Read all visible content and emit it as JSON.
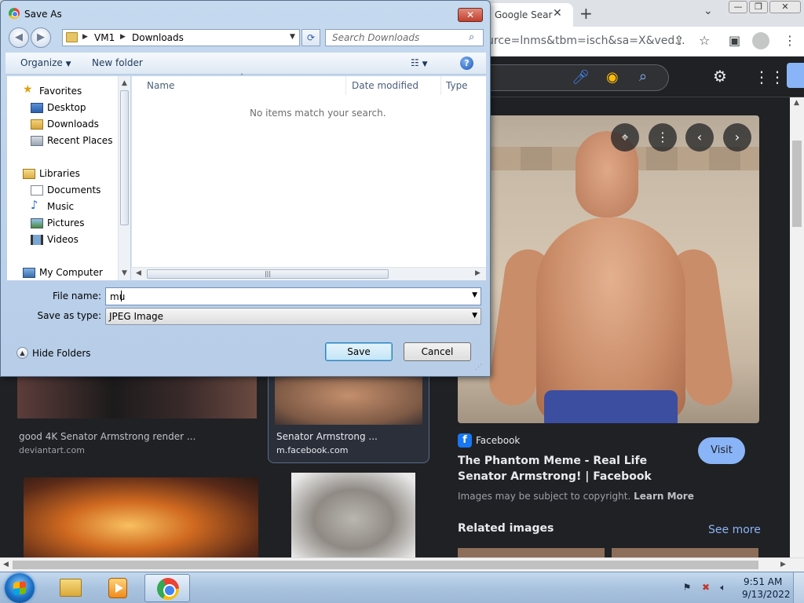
{
  "browser": {
    "tab_title": "Google Sear",
    "url_fragment": "urce=lnms&tbm=isch&sa=X&ved...",
    "tab_close": "✕",
    "new_tab": "+",
    "tab_search_icon": "chevron-down-icon",
    "window_controls": [
      "minimize",
      "maximize",
      "close"
    ]
  },
  "google": {
    "results": [
      {
        "caption": "good 4K Senator Armstrong render ...",
        "source": "deviantart.com"
      },
      {
        "caption": "Senator Armstrong ...",
        "source": "m.facebook.com",
        "selected": true
      }
    ],
    "preview": {
      "source_name": "Facebook",
      "source_logo": "f",
      "title": "The Phantom Meme - Real Life Senator Armstrong! | Facebook",
      "visit_label": "Visit",
      "copyright_text": "Images may be subject to copyright.",
      "learn_more": "Learn More",
      "related_label": "Related images",
      "see_more": "See more"
    },
    "accent_color": "#8ab4f8"
  },
  "dialog": {
    "title": "Save As",
    "close_label": "✕",
    "breadcrumb": [
      "VM1",
      "Downloads"
    ],
    "search_placeholder": "Search Downloads",
    "toolbar": {
      "organize": "Organize",
      "new_folder": "New folder",
      "help": "?"
    },
    "nav": {
      "favorites": "Favorites",
      "desktop": "Desktop",
      "downloads": "Downloads",
      "recent_places": "Recent Places",
      "libraries": "Libraries",
      "documents": "Documents",
      "music": "Music",
      "pictures": "Pictures",
      "videos": "Videos",
      "my_computer": "My Computer"
    },
    "columns": {
      "name": "Name",
      "date_modified": "Date modified",
      "type": "Type"
    },
    "empty_message": "No items match your search.",
    "file_name_label": "File name:",
    "file_name_value": "mu",
    "save_as_type_label": "Save as type:",
    "save_as_type_value": "JPEG Image",
    "hide_folders": "Hide Folders",
    "save_button": "Save",
    "cancel_button": "Cancel"
  },
  "taskbar": {
    "apps": [
      "windows-explorer",
      "media-player",
      "google-chrome"
    ],
    "active_app": "google-chrome",
    "time": "9:51 AM",
    "date": "9/13/2022"
  }
}
